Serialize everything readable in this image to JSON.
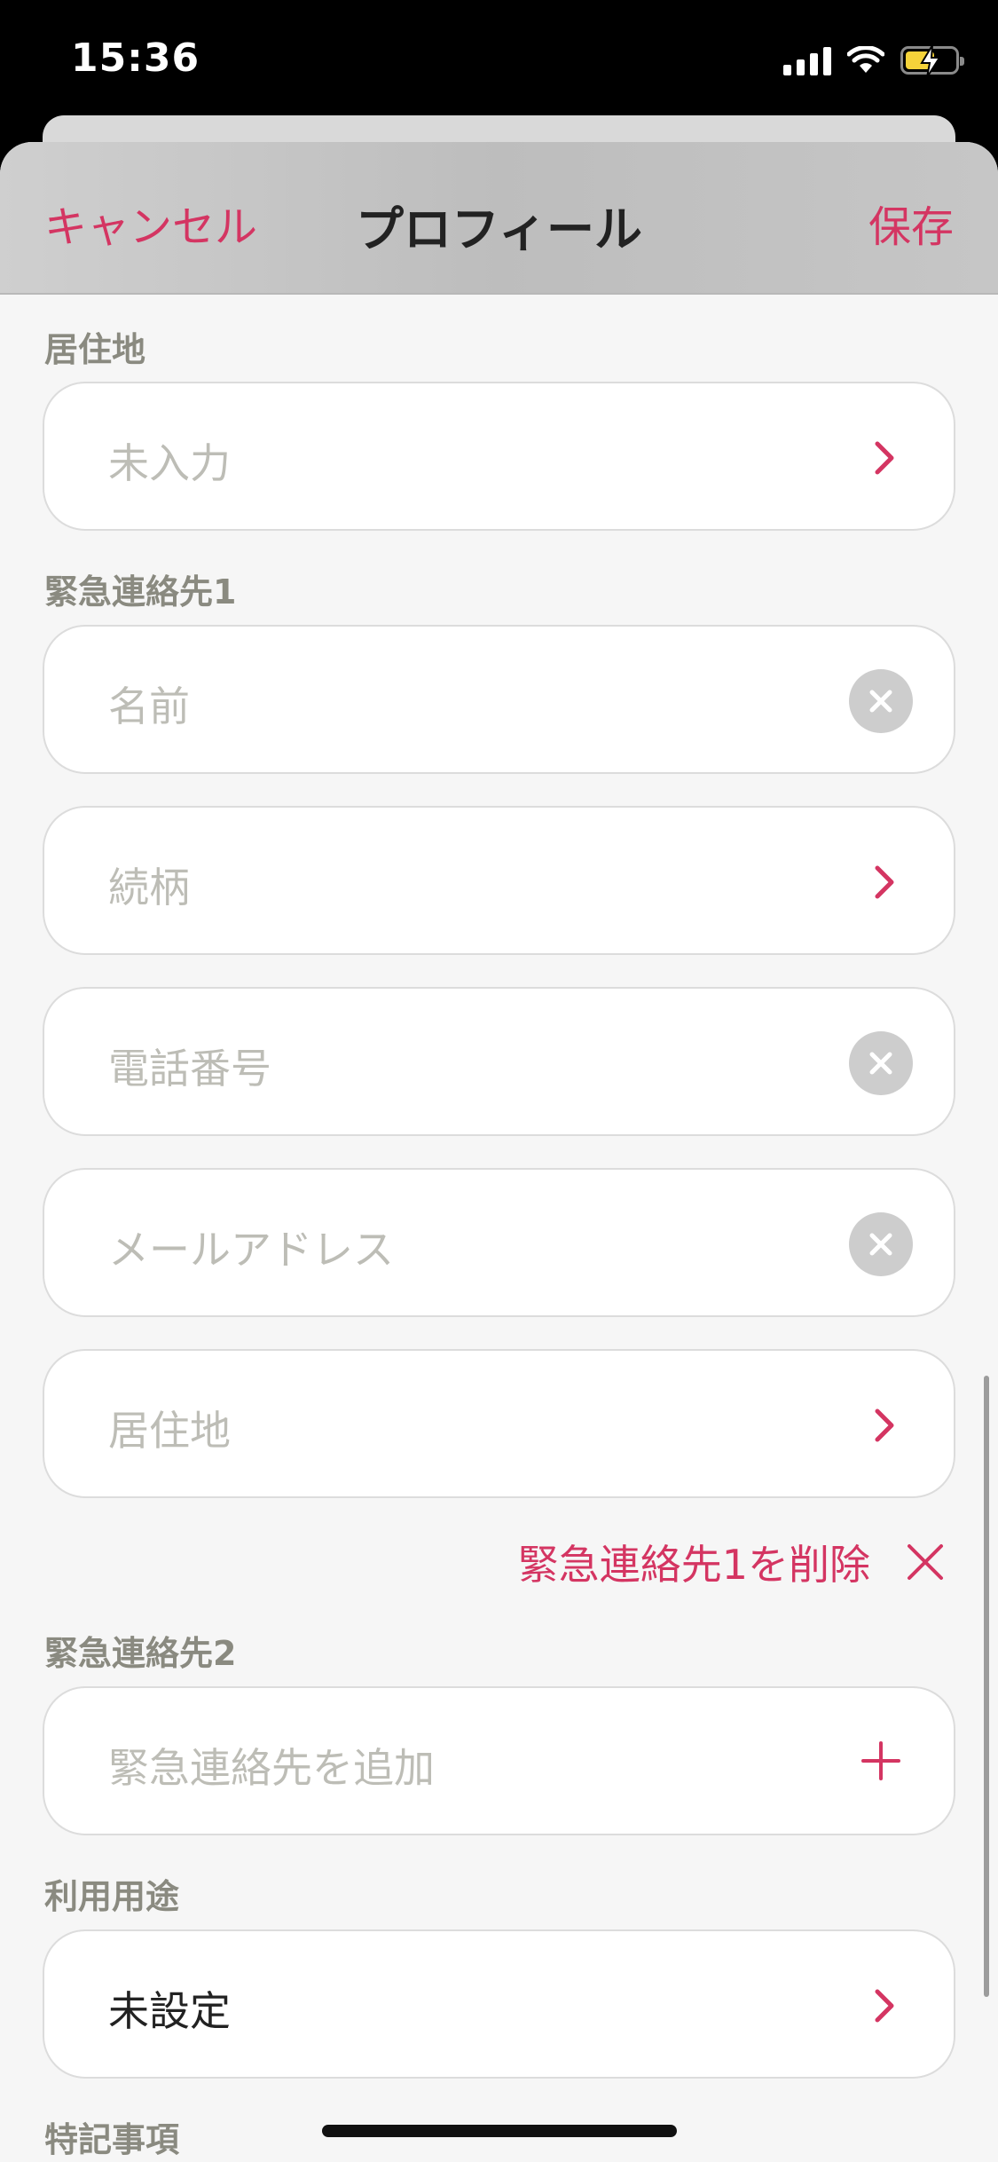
{
  "status_bar": {
    "time": "15:36"
  },
  "nav": {
    "cancel_label": "キャンセル",
    "title": "プロフィール",
    "save_label": "保存"
  },
  "residence": {
    "label": "居住地",
    "value": "未入力"
  },
  "emergency_contact_1": {
    "label": "緊急連絡先1",
    "name_placeholder": "名前",
    "relationship_placeholder": "続柄",
    "phone_placeholder": "電話番号",
    "email_placeholder": "メールアドレス",
    "residence_placeholder": "居住地",
    "delete_label": "緊急連絡先1を削除"
  },
  "emergency_contact_2": {
    "label": "緊急連絡先2",
    "add_label": "緊急連絡先を追加"
  },
  "usage": {
    "label": "利用用途",
    "value": "未設定"
  },
  "notes": {
    "label": "特記事項"
  },
  "colors": {
    "accent": "#d43562",
    "placeholder": "#bdbdb6",
    "section_label": "#8a8a80",
    "background": "#f6f6f6"
  }
}
